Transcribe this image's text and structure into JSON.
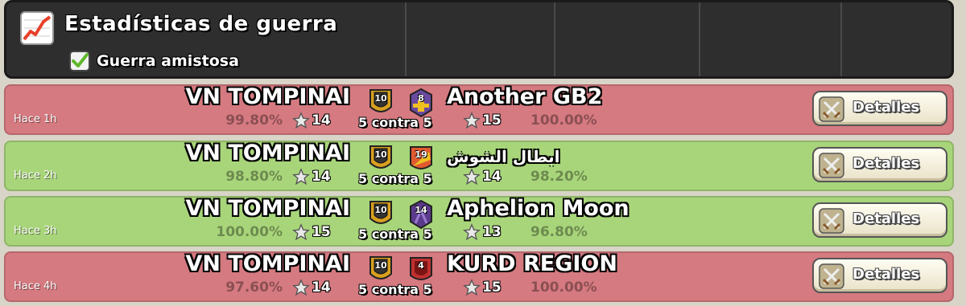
{
  "header": {
    "title": "Estadísticas de guerra",
    "filter_label": "Guerra amistosa",
    "filter_checked": true
  },
  "versus_label": "5 contra 5",
  "details_label": "Detalles",
  "colors": {
    "loss": "#d57a80",
    "win": "#a8d57a"
  },
  "wars": [
    {
      "result": "loss",
      "time": "Hace 1h",
      "home": {
        "name": "VN TOMPINAI",
        "level": "10",
        "stars": "14",
        "pct": "99.80%"
      },
      "away": {
        "name": "Another GB2",
        "level": "8",
        "stars": "15",
        "pct": "100.00%"
      }
    },
    {
      "result": "win",
      "time": "Hace 2h",
      "home": {
        "name": "VN TOMPINAI",
        "level": "10",
        "stars": "14",
        "pct": "98.80%"
      },
      "away": {
        "name": "ابطال الشوش",
        "level": "19",
        "stars": "14",
        "pct": "98.20%"
      }
    },
    {
      "result": "win",
      "time": "Hace 3h",
      "home": {
        "name": "VN TOMPINAI",
        "level": "10",
        "stars": "15",
        "pct": "100.00%"
      },
      "away": {
        "name": "Aphelion Moon",
        "level": "14",
        "stars": "13",
        "pct": "96.80%"
      }
    },
    {
      "result": "loss",
      "time": "Hace 4h",
      "home": {
        "name": "VN TOMPINAI",
        "level": "10",
        "stars": "14",
        "pct": "97.60%"
      },
      "away": {
        "name": "KURD REGION",
        "level": "4",
        "stars": "15",
        "pct": "100.00%"
      }
    }
  ]
}
